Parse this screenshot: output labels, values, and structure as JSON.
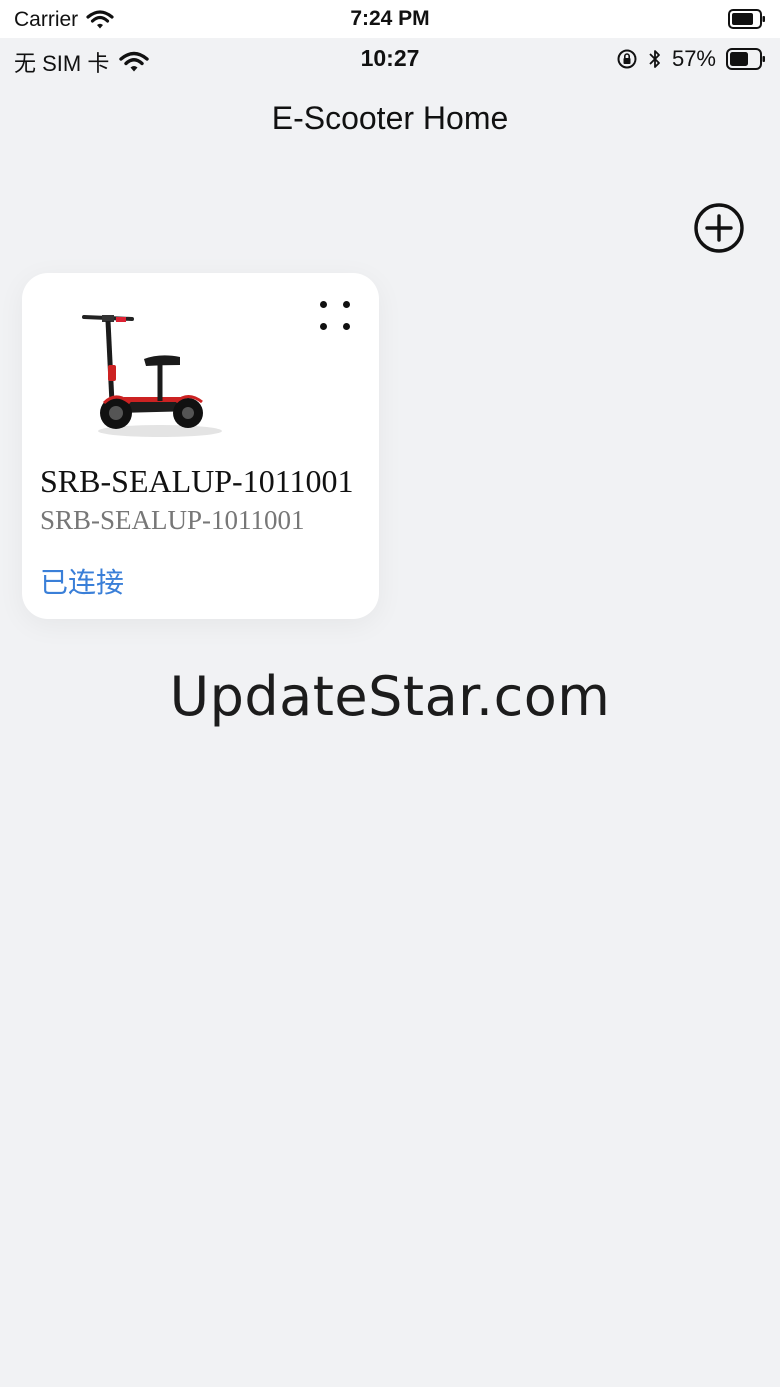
{
  "outer_status_bar": {
    "carrier": "Carrier",
    "time": "7:24 PM"
  },
  "inner_status_bar": {
    "carrier": "无 SIM 卡",
    "time": "10:27",
    "battery_percent": "57%"
  },
  "nav": {
    "title": "E-Scooter Home"
  },
  "devices": [
    {
      "name": "SRB-SEALUP-1011001",
      "id": "SRB-SEALUP-1011001",
      "status": "已连接"
    }
  ],
  "watermark": "UpdateStar.com",
  "colors": {
    "background": "#f1f2f4",
    "card": "#ffffff",
    "status_connected": "#3a7fd8"
  },
  "icons": {
    "add": "add-circle-icon",
    "more": "more-dots-icon",
    "wifi": "wifi-icon",
    "bluetooth": "bluetooth-icon",
    "rotation_lock": "rotation-lock-icon",
    "battery": "battery-icon"
  }
}
